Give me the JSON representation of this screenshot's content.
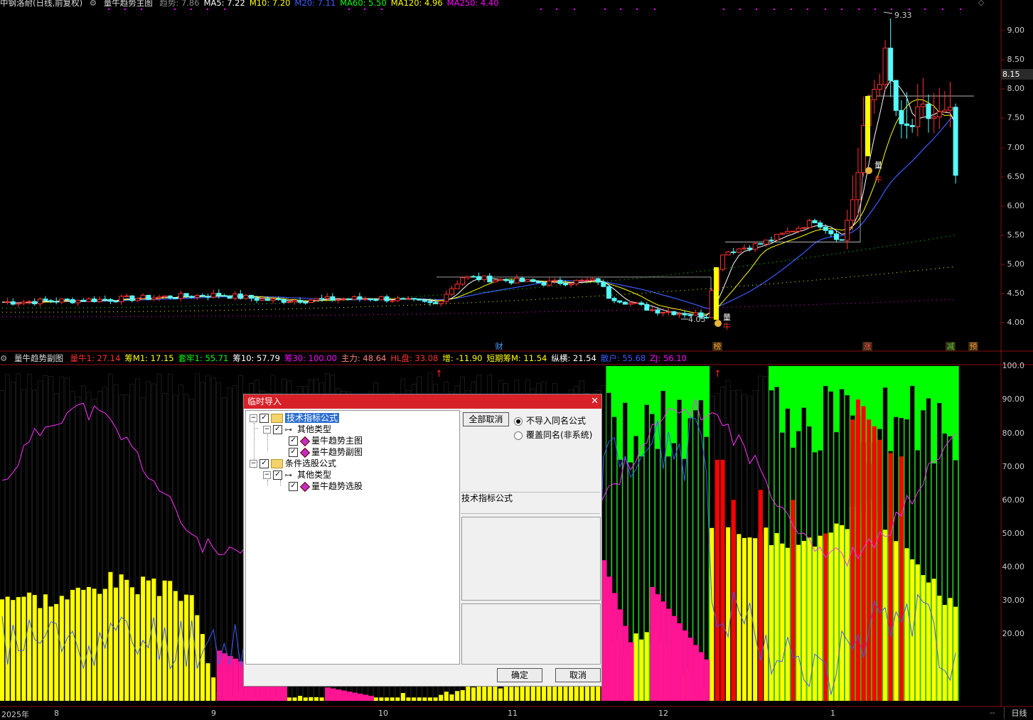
{
  "main_header": {
    "stock_name": "中钢洛耐(日线,前复权)",
    "indicator_name": "量牛趋势主图",
    "values": [
      {
        "label": "趋势: 7.86",
        "color": "#888888"
      },
      {
        "label": "MA5: 7.22",
        "color": "#ffffff"
      },
      {
        "label": "M10: 7.20",
        "color": "#ffff00"
      },
      {
        "label": "M20: 7.11",
        "color": "#3b5bff"
      },
      {
        "label": "MA60: 5.50",
        "color": "#00ff00"
      },
      {
        "label": "MA120: 4.96",
        "color": "#ffff00"
      },
      {
        "label": "MA250: 4.40",
        "color": "#ff00ff"
      }
    ]
  },
  "sub_header": {
    "indicator_name": "量牛趋势副图",
    "values": [
      {
        "label": "量牛1: 27.14",
        "color": "#ff3030"
      },
      {
        "label": "筹M1: 17.15",
        "color": "#ffff00"
      },
      {
        "label": "套牢1: 55.71",
        "color": "#00ff00"
      },
      {
        "label": "筹10: 57.79",
        "color": "#ffffff"
      },
      {
        "label": "筹30: 100.00",
        "color": "#ff00ff"
      },
      {
        "label": "主力: 48.64",
        "color": "#ff8080"
      },
      {
        "label": "HL盘: 33.08",
        "color": "#ff3030"
      },
      {
        "label": "增: -11.90",
        "color": "#ffff00"
      },
      {
        "label": "短期筹M: 11.54",
        "color": "#ffff00"
      },
      {
        "label": "纵横: 21.54",
        "color": "#ffffff"
      },
      {
        "label": "散户: 55.68",
        "color": "#3b5bff"
      },
      {
        "label": "ZJ: 56.10",
        "color": "#ff00ff"
      }
    ]
  },
  "price_axis": [
    "9.00",
    "8.50",
    "8.00",
    "7.50",
    "7.00",
    "6.50",
    "6.00",
    "5.50",
    "5.00",
    "4.50",
    "4.00"
  ],
  "current_price": "8.15",
  "sub_axis": [
    "100.0",
    "90.00",
    "80.00",
    "70.00",
    "60.00",
    "50.00",
    "40.00",
    "30.00",
    "20.00"
  ],
  "date_axis": [
    "2025年",
    "8",
    "9",
    "10",
    "11",
    "12",
    "1"
  ],
  "annotations": {
    "high": "9.33",
    "low": "4.05",
    "signal_volume": "量",
    "signal_bull": "牛"
  },
  "events": [
    {
      "label": "财",
      "color": "#4aa0ff"
    },
    {
      "label": "榜",
      "color": "#ffa030"
    },
    {
      "label": "涨",
      "color": "#ff5050"
    },
    {
      "label": "减",
      "color": "#40d040"
    },
    {
      "label": "预",
      "color": "#ffa030"
    }
  ],
  "period_tab": "日线",
  "nav_button": "--",
  "dialog": {
    "title": "临时导入",
    "close": "✕",
    "tree": [
      {
        "label": "技术指标公式",
        "level": 0,
        "type": "folder",
        "selected": true
      },
      {
        "label": "其他类型",
        "level": 1,
        "type": "key"
      },
      {
        "label": "量牛趋势主图",
        "level": 2,
        "type": "item"
      },
      {
        "label": "量牛趋势副图",
        "level": 2,
        "type": "item"
      },
      {
        "label": "条件选股公式",
        "level": 0,
        "type": "folder"
      },
      {
        "label": "其他类型",
        "level": 1,
        "type": "key"
      },
      {
        "label": "量牛趋势选股",
        "level": 2,
        "type": "item"
      }
    ],
    "cancel_all_button": "全部取消",
    "option_no_import": "不导入同名公式",
    "option_overwrite": "覆盖同名(非系统)",
    "description_label": "技术指标公式",
    "ok_button": "确定",
    "cancel_button": "取消"
  },
  "colors": {
    "up": "#ff3232",
    "down": "#54fcfc",
    "ma5": "#ffffff",
    "ma10": "#ffff00",
    "ma20": "#3b5bff",
    "bull": "#ffff00",
    "bear": "#000000",
    "green": "#00ff00",
    "pink": "#ff1493",
    "red": "#ff0000"
  }
}
